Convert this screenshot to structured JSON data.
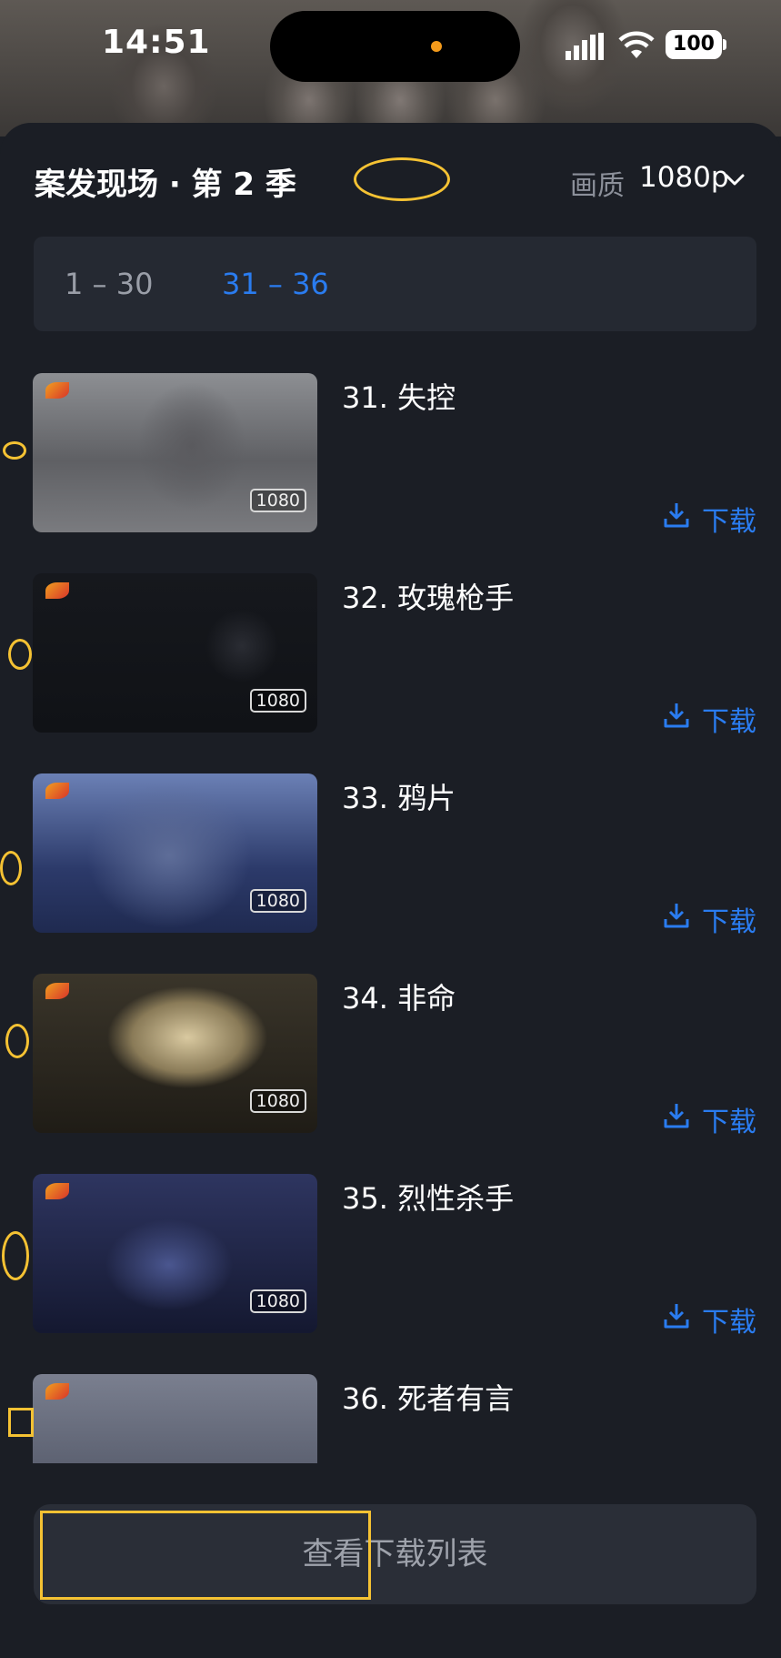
{
  "status": {
    "time": "14:51",
    "battery": "100"
  },
  "sheet": {
    "title": "案发现场 · 第 2 季",
    "quality_label": "画质",
    "quality_value": "1080p"
  },
  "ranges": [
    "1 – 30",
    "31 – 36"
  ],
  "episodes": [
    {
      "title": "31. 失控",
      "res": "1080",
      "download": "下载"
    },
    {
      "title": "32. 玫瑰枪手",
      "res": "1080",
      "download": "下载"
    },
    {
      "title": "33. 鸦片",
      "res": "1080",
      "download": "下载"
    },
    {
      "title": "34. 非命",
      "res": "1080",
      "download": "下载"
    },
    {
      "title": "35. 烈性杀手",
      "res": "1080",
      "download": "下载"
    },
    {
      "title": "36. 死者有言"
    }
  ],
  "footer": {
    "button": "查看下载列表"
  },
  "colors": {
    "accent": "#2a7cf0",
    "annotation": "#f5c233",
    "background": "#1b1e25"
  }
}
